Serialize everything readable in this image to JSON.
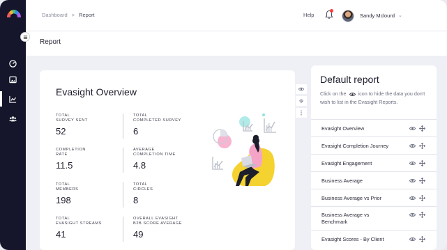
{
  "breadcrumb": {
    "home": "Dashboard",
    "separator": ">",
    "current": "Report"
  },
  "header": {
    "help": "Help",
    "user_name": "Sandy Mclourd",
    "chevron": "⌄"
  },
  "page": {
    "title": "Report"
  },
  "sidebar": {
    "items": [
      {
        "icon": "dashboard-gauge-icon"
      },
      {
        "icon": "image-gallery-icon"
      },
      {
        "icon": "line-chart-icon",
        "active": true
      },
      {
        "icon": "users-group-icon"
      }
    ]
  },
  "overview": {
    "title": "Evasight Overview",
    "stats": [
      {
        "label_line1": "TOTAL",
        "label_line2": "SURVEY SENT",
        "value": "52"
      },
      {
        "label_line1": "TOTAL",
        "label_line2": "COMPLETED SURVEY",
        "value": "6"
      },
      {
        "label_line1": "COMPLETION",
        "label_line2": "RATE",
        "value": "11.5"
      },
      {
        "label_line1": "AVERAGE",
        "label_line2": "COMPLETION TIME",
        "value": "4.8"
      },
      {
        "label_line1": "TOTAL",
        "label_line2": "MEMBERS",
        "value": "198"
      },
      {
        "label_line1": "TOTAL",
        "label_line2": "CIRCLES",
        "value": "8"
      },
      {
        "label_line1": "TOTAL",
        "label_line2": "EVASIGHT STREAMS",
        "value": "41"
      },
      {
        "label_line1": "OVERALL EVASIGHT",
        "label_line2": "B2B SCORE AVERAGE",
        "value": "49"
      }
    ]
  },
  "report_panel": {
    "title": "Default report",
    "desc_before": "Click on the",
    "desc_after": "icon to hide the data you don't wish to list in the Evasight Reports.",
    "items": [
      {
        "label": "Evasight Overview"
      },
      {
        "label": "Evasight Completion Journey"
      },
      {
        "label": "Evasight Engagement"
      },
      {
        "label": "Business Average"
      },
      {
        "label": "Business Average vs Prior"
      },
      {
        "label": "Business Average vs Benchmark"
      },
      {
        "label": "Evasight Scores - By Client"
      }
    ]
  },
  "colors": {
    "sidebar": "#15162b",
    "illustration_yellow": "#f4d230",
    "illustration_pink": "#f5a3c7",
    "illustration_teal": "#8fe3de"
  }
}
